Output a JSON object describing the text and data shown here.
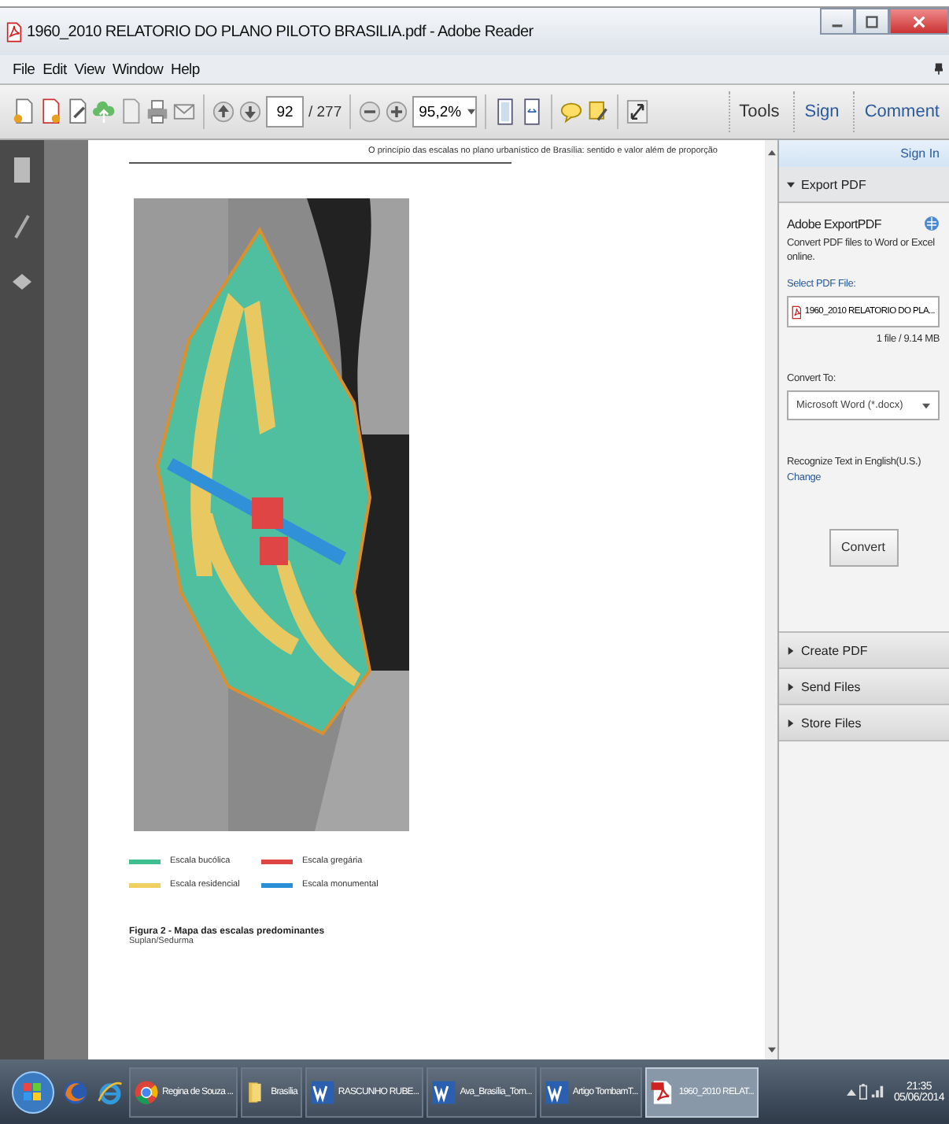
{
  "window": {
    "title": "1960_2010  RELATORIO DO PLANO PILOTO BRASILIA.pdf - Adobe Reader"
  },
  "menu": [
    "File",
    "Edit",
    "View",
    "Window",
    "Help"
  ],
  "toolbar": {
    "page": "92",
    "page_count": "/ 277",
    "zoom": "95,2%",
    "tabs": [
      "Tools",
      "Sign",
      "Comment"
    ]
  },
  "document": {
    "header": "O princípio das escalas no plano urbanístico de Brasília: sentido e valor além de proporção",
    "legend": [
      {
        "label": "Escala bucólica",
        "color": "#3dbf8f"
      },
      {
        "label": "Escala gregária",
        "color": "#e04545"
      },
      {
        "label": "Escala residencial",
        "color": "#f0d060"
      },
      {
        "label": "Escala monumental",
        "color": "#2a8fd6"
      }
    ],
    "caption": "Figura 2 - Mapa das escalas predominantes",
    "source": "Suplan/Sedurma"
  },
  "panel": {
    "sign_in": "Sign In",
    "sections": [
      {
        "title": "Export PDF",
        "expanded": true
      },
      {
        "title": "Create PDF",
        "expanded": false
      },
      {
        "title": "Send Files",
        "expanded": false
      },
      {
        "title": "Store Files",
        "expanded": false
      }
    ],
    "export": {
      "heading": "Adobe ExportPDF",
      "description": "Convert PDF files to Word or Excel online.",
      "select_label": "Select PDF File:",
      "file": "1960_2010  RELATORIO DO PLA...",
      "file_info": "1 file / 9.14 MB",
      "convert_label": "Convert To:",
      "format": "Microsoft Word (*.docx)",
      "ocr": "Recognize Text in English(U.S.)",
      "change": "Change",
      "button": "Convert"
    }
  },
  "taskbar": {
    "tasks": [
      {
        "kind": "chrome",
        "label": "Regina de Souza ...",
        "selected": false
      },
      {
        "kind": "folder",
        "label": "Brasília",
        "selected": false
      },
      {
        "kind": "word",
        "label": "RASCUNHO RUBE...",
        "selected": false
      },
      {
        "kind": "word",
        "label": "Ava_Brasília_Tom...",
        "selected": false
      },
      {
        "kind": "word",
        "label": "Artigo TombamT...",
        "selected": false
      },
      {
        "kind": "pdf",
        "label": "1960_2010  RELAT...",
        "selected": true
      }
    ],
    "time": "21:35",
    "date": "05/06/2014"
  }
}
